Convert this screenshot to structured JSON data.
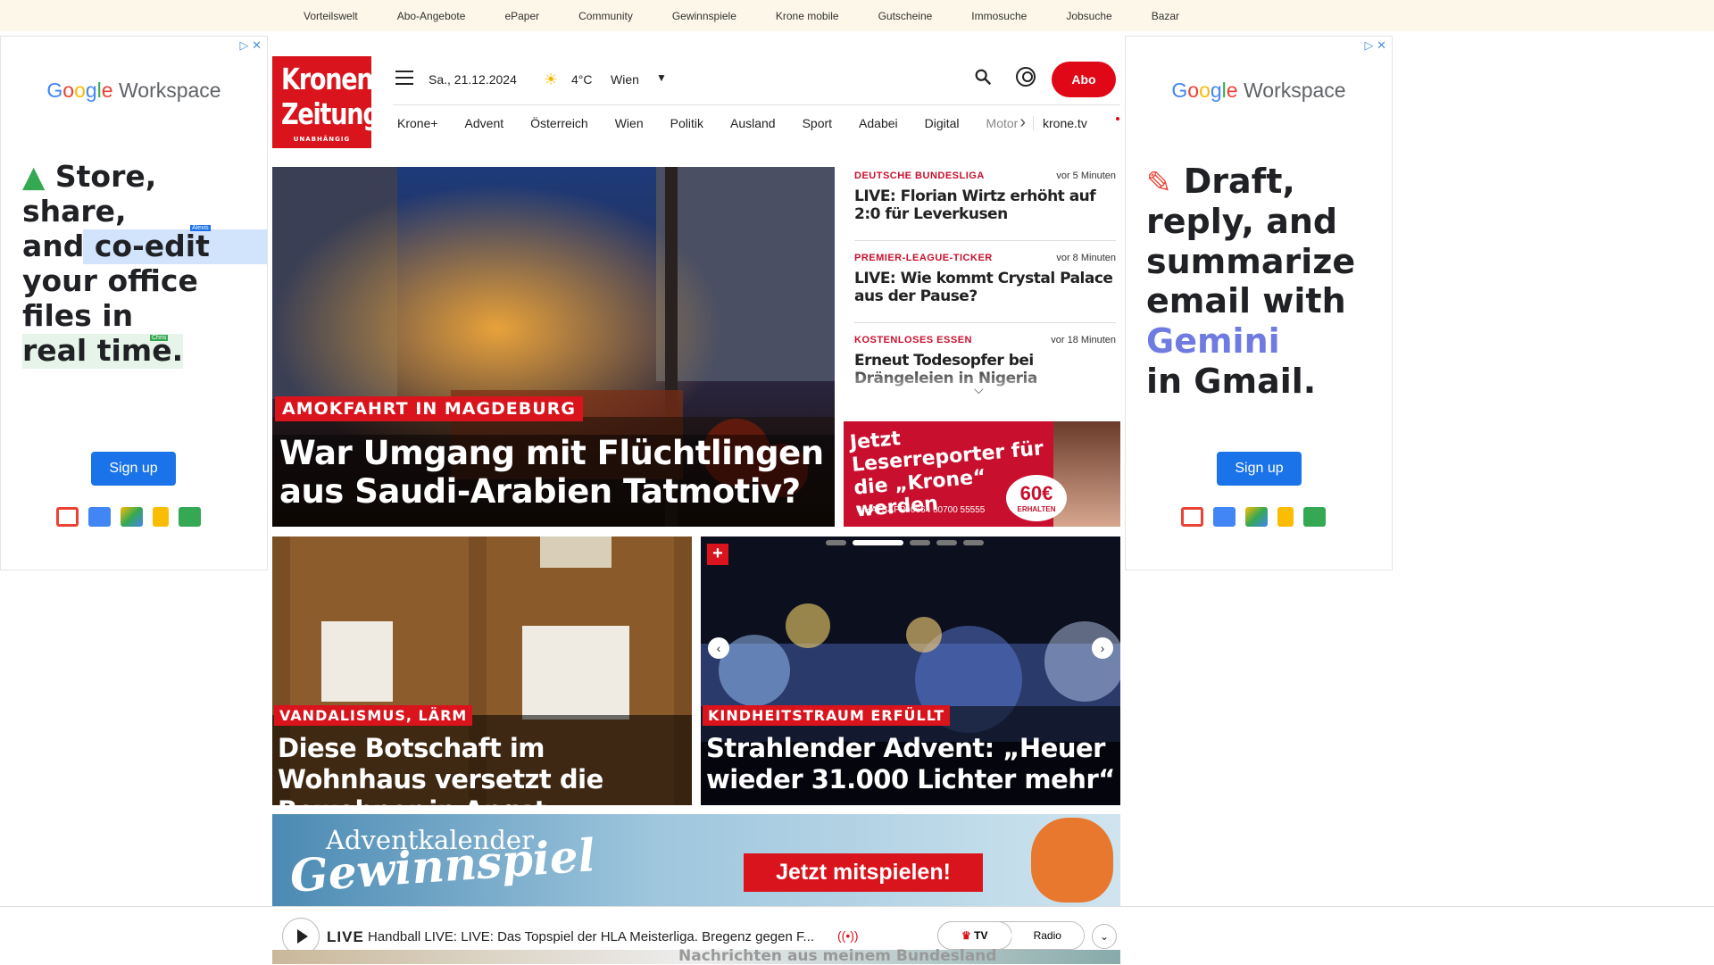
{
  "topnav": [
    "Vorteilswelt",
    "Abo-Angebote",
    "ePaper",
    "Community",
    "Gewinnspiele",
    "Krone mobile",
    "Gutscheine",
    "Immosuche",
    "Jobsuche",
    "Bazar"
  ],
  "ads": {
    "brand": "Google Workspace",
    "left_lines": [
      "Store, share,",
      "and co-edit",
      "your office",
      "files in",
      "real time."
    ],
    "left_tags": [
      "Alexis",
      "Chris"
    ],
    "right_lines": [
      "Draft,",
      "reply, and",
      "summarize",
      "email with",
      "Gemini",
      "in Gmail."
    ],
    "signup": "Sign up",
    "colors": {
      "blue": "#1a73e8",
      "red": "#ea4335",
      "yellow": "#fbbc04",
      "green": "#34a853"
    }
  },
  "header": {
    "logo_line1": "Kronen",
    "logo_line2": "Zeitung",
    "logo_tag": "UNABHÄNGIG",
    "date": "Sa., 21.12.2024",
    "temperature": "4°C",
    "city": "Wien",
    "abo": "Abo"
  },
  "nav": [
    "Krone+",
    "Advent",
    "Österreich",
    "Wien",
    "Politik",
    "Ausland",
    "Sport",
    "Adabei",
    "Digital"
  ],
  "nav_motor": "Motor",
  "nav_tv": "krone.tv",
  "main_story": {
    "kicker": "AMOKFAHRT IN MAGDEBURG",
    "headline": "War Umgang mit Flüchtlingen aus Saudi-Arabien Tatmotiv?"
  },
  "ticker": [
    {
      "cat": "DEUTSCHE BUNDESLIGA",
      "time": "vor 5 Minuten",
      "title": "LIVE: Florian Wirtz erhöht auf 2:0 für Leverkusen"
    },
    {
      "cat": "PREMIER-LEAGUE-TICKER",
      "time": "vor 8 Minuten",
      "title": "LIVE: Wie kommt Crystal Palace aus der Pause?"
    },
    {
      "cat": "KOSTENLOSES ESSEN",
      "time": "vor 18 Minuten",
      "title": "Erneut Todesopfer bei Drängeleien in Nigeria"
    }
  ],
  "promo": {
    "text": "Jetzt Leserreporter für die „Krone“ werden",
    "whatsapp": "WHATSAPP: 0664 60700 55555",
    "badge": "60€",
    "badge_sub": "ERHALTEN"
  },
  "story2": {
    "kicker": "VANDALISMUS, LÄRM",
    "headline": "Diese Botschaft im Wohnhaus versetzt die Bewohner in Angst"
  },
  "story3": {
    "kicker": "KINDHEITSTRAUM ERFÜLLT",
    "headline": "Strahlender Advent: „Heuer wieder 31.000 Lichter mehr“"
  },
  "advent": {
    "line1": "Adventkalender",
    "line2": "Gewinnspiel",
    "cta": "Jetzt mitspielen!"
  },
  "player": {
    "live": "LIVE",
    "text": "Handball LIVE: LIVE: Das Topspiel der HLA Meisterliga. Bregenz gegen F...",
    "tv": "TV",
    "radio": "Radio"
  },
  "below_text": "Nachrichten aus meinem Bundesland"
}
